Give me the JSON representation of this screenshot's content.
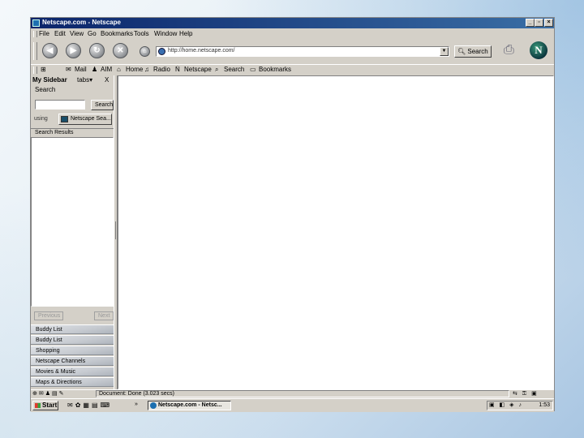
{
  "window": {
    "title": "Netscape.com - Netscape"
  },
  "menubar": {
    "items": [
      "File",
      "Edit",
      "View",
      "Go",
      "Bookmarks",
      "Tools",
      "Window",
      "Help"
    ]
  },
  "navbar": {
    "url": "http://home.netscape.com/",
    "search_label": "Search"
  },
  "personal_toolbar": {
    "items": [
      "Mail",
      "AIM",
      "Home",
      "Radio",
      "Netscape",
      "Search",
      "Bookmarks"
    ]
  },
  "sidebar": {
    "title": "My Sidebar",
    "tabs_label": "tabs",
    "close": "X",
    "search_title": "Search",
    "search_button": "Search",
    "using_label": "using",
    "provider": "Netscape Sea...",
    "results_header": "Search Results",
    "prev_button": "Previous",
    "next_button": "Next",
    "panels": [
      "Buddy List",
      "Buddy List",
      "Shopping",
      "Netscape Channels",
      "Movies & Music",
      "Maps & Directions"
    ]
  },
  "status": {
    "text": "Document: Done (3.023 secs)"
  },
  "taskbar": {
    "start_label": "Start",
    "more": "»",
    "task": "Netscape.com - Netsc...",
    "clock": "1:53"
  }
}
